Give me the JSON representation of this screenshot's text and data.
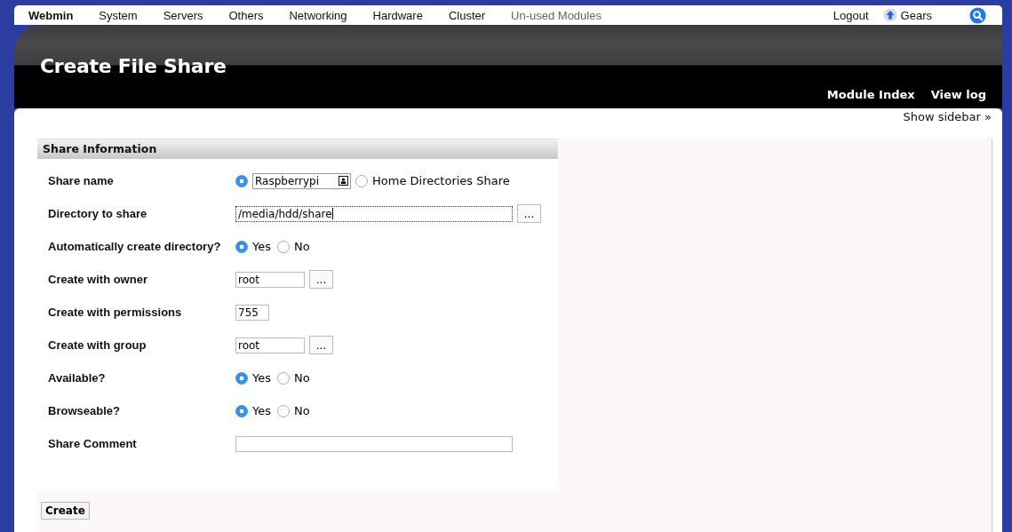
{
  "nav": {
    "items": [
      {
        "label": "Webmin",
        "selected": true
      },
      {
        "label": "System",
        "selected": false
      },
      {
        "label": "Servers",
        "selected": false
      },
      {
        "label": "Others",
        "selected": false
      },
      {
        "label": "Networking",
        "selected": false
      },
      {
        "label": "Hardware",
        "selected": false
      },
      {
        "label": "Cluster",
        "selected": false
      },
      {
        "label": "Un-used Modules",
        "selected": false,
        "disabled": true
      }
    ],
    "logout": "Logout",
    "user": "Gears"
  },
  "header": {
    "title": "Create File Share",
    "links": [
      "Module Index",
      "View log"
    ]
  },
  "show_sidebar": "Show sidebar »",
  "section": {
    "title": "Share Information",
    "fields": [
      {
        "label": "Share name",
        "kind": "share_name",
        "options": [
          {
            "kind": "input",
            "value": "Raspberrypi",
            "selected": true
          },
          {
            "kind": "label",
            "label": "Home Directories Share",
            "selected": false
          }
        ]
      },
      {
        "label": "Directory to share",
        "kind": "wide_text",
        "value": "/media/hdd/share",
        "focused": true,
        "browse": "..."
      },
      {
        "label": "Automatically create directory?",
        "kind": "radio",
        "options": [
          {
            "label": "Yes",
            "selected": true
          },
          {
            "label": "No",
            "selected": false
          }
        ]
      },
      {
        "label": "Create with owner",
        "kind": "text",
        "value": "root",
        "browse": "..."
      },
      {
        "label": "Create with permissions",
        "kind": "number",
        "value": "755"
      },
      {
        "label": "Create with group",
        "kind": "text",
        "value": "root",
        "browse": "..."
      },
      {
        "label": "Available?",
        "kind": "radio",
        "options": [
          {
            "label": "Yes",
            "selected": true
          },
          {
            "label": "No",
            "selected": false
          }
        ]
      },
      {
        "label": "Browseable?",
        "kind": "radio",
        "options": [
          {
            "label": "Yes",
            "selected": true
          },
          {
            "label": "No",
            "selected": false
          }
        ]
      },
      {
        "label": "Share Comment",
        "kind": "wide_text"
      }
    ]
  },
  "submit": "Create"
}
